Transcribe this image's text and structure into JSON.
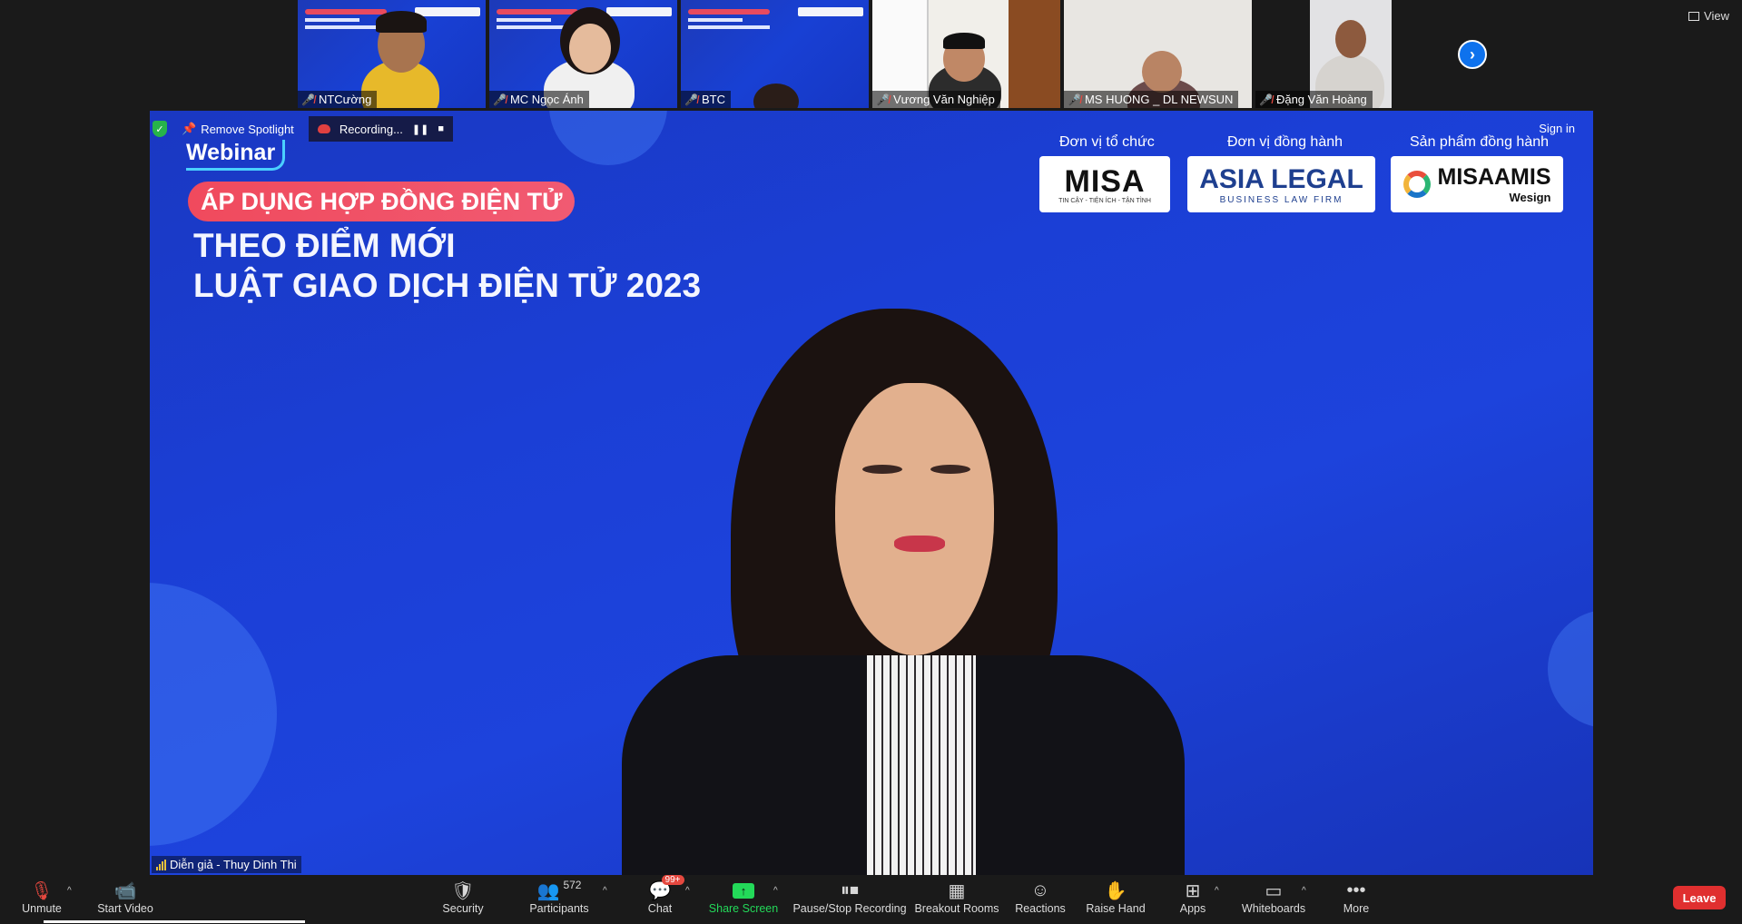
{
  "participants_strip": [
    {
      "name": "NTCường",
      "muted": true
    },
    {
      "name": "MC Ngọc Ánh",
      "muted": true
    },
    {
      "name": "BTC",
      "muted": true
    },
    {
      "name": "Vương Văn Nghiệp",
      "muted": true
    },
    {
      "name": "MS HUONG _ DL NEWSUN",
      "muted": true
    },
    {
      "name": "Đặng Văn Hoàng",
      "muted": true
    }
  ],
  "view_label": "View",
  "spotlight": {
    "remove_label": "Remove Spotlight",
    "recording_label": "Recording..."
  },
  "sign_in_label": "Sign in",
  "slide": {
    "webinar_label": "Webinar",
    "pill_title": "ÁP DỤNG HỢP ĐỒNG ĐIỆN TỬ",
    "title_line1": "THEO ĐIỂM MỚI",
    "title_line2": "LUẬT GIAO DỊCH ĐIỆN TỬ 2023",
    "organizer_heading": "Đơn vị tổ chức",
    "partner_heading": "Đơn vị đồng hành",
    "product_heading": "Sản phẩm đồng hành",
    "misa_logo": "MISA",
    "misa_tagline": "TIN CẬY - TIỆN ÍCH - TẬN TÌNH",
    "asia_logo": "ASIA LEGAL",
    "asia_tagline": "BUSINESS LAW FIRM",
    "amis_logo": "MISAAMIS",
    "amis_sub": "Wesign"
  },
  "speaker_label": "Diễn giả - Thuy Dinh Thi",
  "toolbar": {
    "unmute": "Unmute",
    "start_video": "Start Video",
    "security": "Security",
    "participants": "Participants",
    "participants_count": "572",
    "chat": "Chat",
    "chat_badge": "99+",
    "share_screen": "Share Screen",
    "recording": "Pause/Stop Recording",
    "breakout_rooms": "Breakout Rooms",
    "reactions": "Reactions",
    "raise_hand": "Raise Hand",
    "apps": "Apps",
    "whiteboards": "Whiteboards",
    "more": "More",
    "leave": "Leave"
  },
  "colors": {
    "accent_blue": "#0e72ed",
    "share_green": "#23d959",
    "leave_red": "#e02f2f",
    "slide_blue": "#1b3fd6",
    "pill_red": "#f04a5d"
  }
}
